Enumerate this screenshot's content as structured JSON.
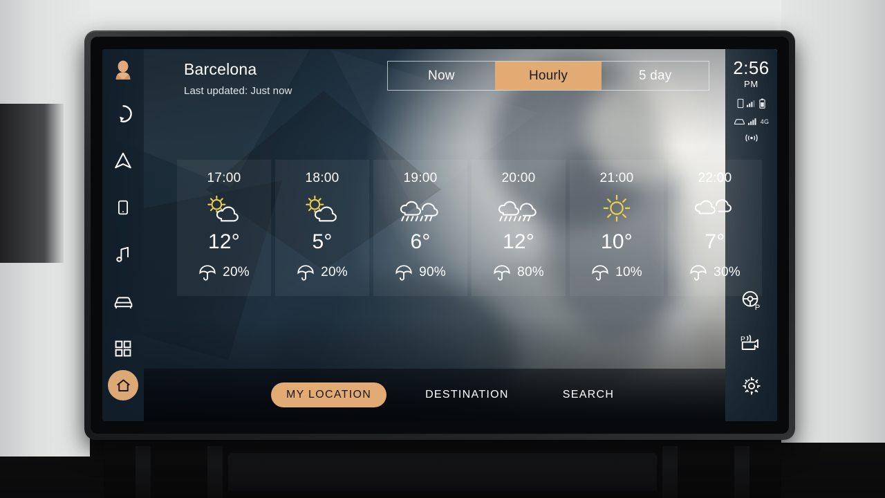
{
  "device": {
    "type": "car-infotainment-touchscreen"
  },
  "header": {
    "city": "Barcelona",
    "updated": "Last updated: Just now",
    "avatar_icon": "user-avatar-icon"
  },
  "tabs": [
    {
      "label": "Now",
      "active": false
    },
    {
      "label": "Hourly",
      "active": true
    },
    {
      "label": "5 day",
      "active": false
    }
  ],
  "status": {
    "time": "2:56",
    "ampm": "PM",
    "phone_icon": "phone-icon",
    "phone_signal_bars": 3,
    "battery_icon": "battery-icon",
    "car_icon": "car-icon",
    "car_signal_bars": 5,
    "network": "4G",
    "broadcast_icon": "wifi-broadcast-icon"
  },
  "sidebar": {
    "items": [
      {
        "name": "voice-assistant",
        "icon": "voice-circle-icon"
      },
      {
        "name": "navigation",
        "icon": "navigation-arrow-icon"
      },
      {
        "name": "phone",
        "icon": "phone-icon"
      },
      {
        "name": "media",
        "icon": "music-note-icon"
      },
      {
        "name": "vehicle",
        "icon": "car-front-icon"
      },
      {
        "name": "apps",
        "icon": "apps-grid-icon"
      }
    ],
    "home_icon": "home-icon"
  },
  "right_controls": [
    {
      "name": "park-assist",
      "icon": "steering-wheel-park-icon"
    },
    {
      "name": "parking-sensor",
      "icon": "parking-sensor-icon"
    },
    {
      "name": "settings",
      "icon": "gear-icon"
    }
  ],
  "forecast": {
    "unit": "°",
    "items": [
      {
        "hour": "17:00",
        "icon": "partly-sunny-icon",
        "temp": "12°",
        "precip": "20%"
      },
      {
        "hour": "18:00",
        "icon": "partly-sunny-icon",
        "temp": "5°",
        "precip": "20%"
      },
      {
        "hour": "19:00",
        "icon": "rain-icon",
        "temp": "6°",
        "precip": "90%"
      },
      {
        "hour": "20:00",
        "icon": "rain-icon",
        "temp": "12°",
        "precip": "80%"
      },
      {
        "hour": "21:00",
        "icon": "sunny-icon",
        "temp": "10°",
        "precip": "10%"
      },
      {
        "hour": "22:00",
        "icon": "cloudy-icon",
        "temp": "7°",
        "precip": "30%"
      }
    ],
    "precip_icon": "umbrella-icon"
  },
  "bottom_nav": [
    {
      "label": "MY LOCATION",
      "active": true
    },
    {
      "label": "DESTINATION",
      "active": false
    },
    {
      "label": "SEARCH",
      "active": false
    }
  ],
  "colors": {
    "accent": "#e3ab74",
    "screen_dark": "#16222c",
    "text": "#ffffff",
    "sun_yellow": "#f0d24a"
  }
}
